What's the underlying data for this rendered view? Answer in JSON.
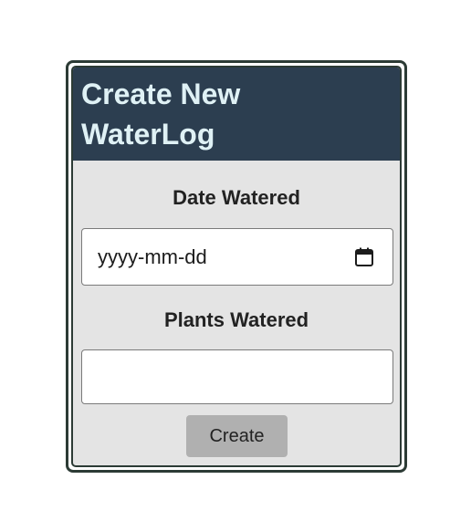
{
  "form": {
    "title": "Create New WaterLog",
    "date_label": "Date Watered",
    "date_placeholder": "yyyy-mm-dd",
    "plants_label": "Plants Watered",
    "plants_value": "",
    "submit_label": "Create"
  },
  "icons": {
    "date_picker": "calendar-icon"
  },
  "colors": {
    "header_bg": "#2c3e50",
    "header_text": "#dff1f5",
    "card_bg": "#e4e4e4",
    "border": "#2c3b35",
    "button_bg": "#b0b0b0"
  }
}
